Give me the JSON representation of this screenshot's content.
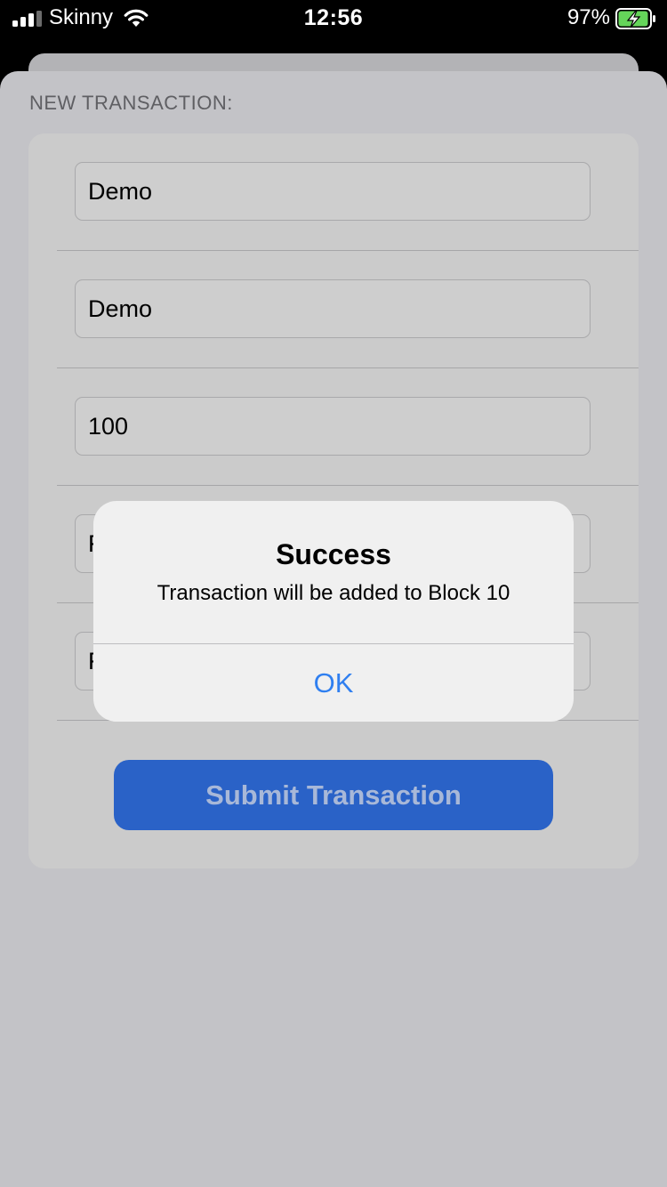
{
  "status_bar": {
    "carrier": "Skinny",
    "time": "12:56",
    "battery_percent": "97%",
    "battery_level": 0.97,
    "charging": true,
    "signal_bars": 3
  },
  "form": {
    "section_header": "NEW TRANSACTION:",
    "fields": [
      {
        "value": "Demo"
      },
      {
        "value": "Demo"
      },
      {
        "value": "100"
      },
      {
        "value": "F"
      },
      {
        "value": "F"
      }
    ],
    "submit_label": "Submit Transaction"
  },
  "alert": {
    "title": "Success",
    "message": "Transaction will be added to Block 10",
    "ok_label": "OK"
  },
  "colors": {
    "accent": "#2f7ff0",
    "button_bg": "#2a62c7",
    "battery_green": "#65d55a"
  }
}
